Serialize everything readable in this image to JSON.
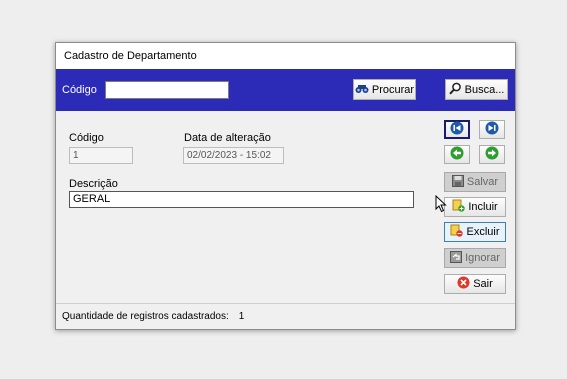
{
  "window": {
    "title": "Cadastro de Departamento"
  },
  "searchbar": {
    "code_label": "Código",
    "code_value": "",
    "procurar_label": "Procurar",
    "busca_label": "Busca..."
  },
  "form": {
    "codigo_label": "Código",
    "codigo_value": "1",
    "data_label": "Data de alteração",
    "data_value": "02/02/2023 - 15:02",
    "descricao_label": "Descrição",
    "descricao_value": "GERAL"
  },
  "actions": {
    "salvar": "Salvar",
    "incluir": "Incluir",
    "excluir": "Excluir",
    "ignorar": "Ignorar",
    "sair": "Sair"
  },
  "nav_icons": [
    "first-record-icon",
    "last-record-icon",
    "previous-record-icon",
    "next-record-icon"
  ],
  "colors": {
    "header_bar": "#2b2bb8",
    "nav_blue": "#1f5aa8",
    "nav_green": "#2e9e2e",
    "exit_red": "#d93a2b"
  },
  "status": {
    "label": "Quantidade de registros cadastrados:",
    "count": "1"
  }
}
